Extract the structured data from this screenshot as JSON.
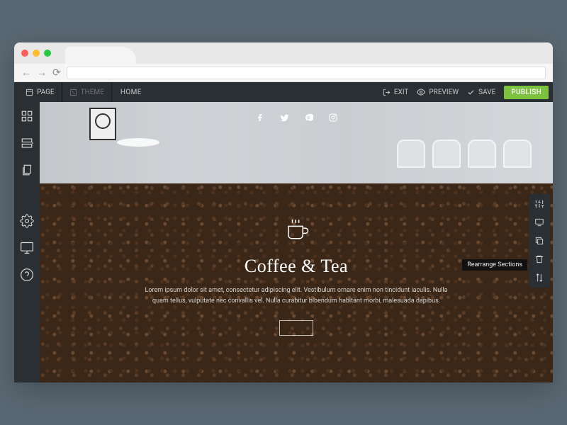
{
  "topbar": {
    "page_label": "PAGE",
    "theme_label": "THEME",
    "current_page": "HOME",
    "exit_label": "EXIT",
    "preview_label": "PREVIEW",
    "save_label": "SAVE",
    "publish_label": "PUBLISH"
  },
  "left_rail": {
    "items": [
      "blocks",
      "add-section",
      "pages",
      "settings",
      "desktop-preview",
      "help"
    ]
  },
  "canvas": {
    "social": [
      "facebook",
      "twitter",
      "pinterest",
      "instagram"
    ],
    "coffee": {
      "title": "Coffee & Tea",
      "body": "Lorem ipsum dolor sit amet, consectetur adipiscing elit. Vestibulum ornare enim non tincidunt iaculis. Nulla quam tellus, vulputate nec convallis vel. Nulla curabitur bibendum habitant morbi, malesuada dapibus."
    }
  },
  "right_panel": {
    "items": [
      "section-settings",
      "duplicate",
      "copy",
      "delete",
      "rearrange"
    ],
    "tooltip": "Rearrange Sections"
  }
}
